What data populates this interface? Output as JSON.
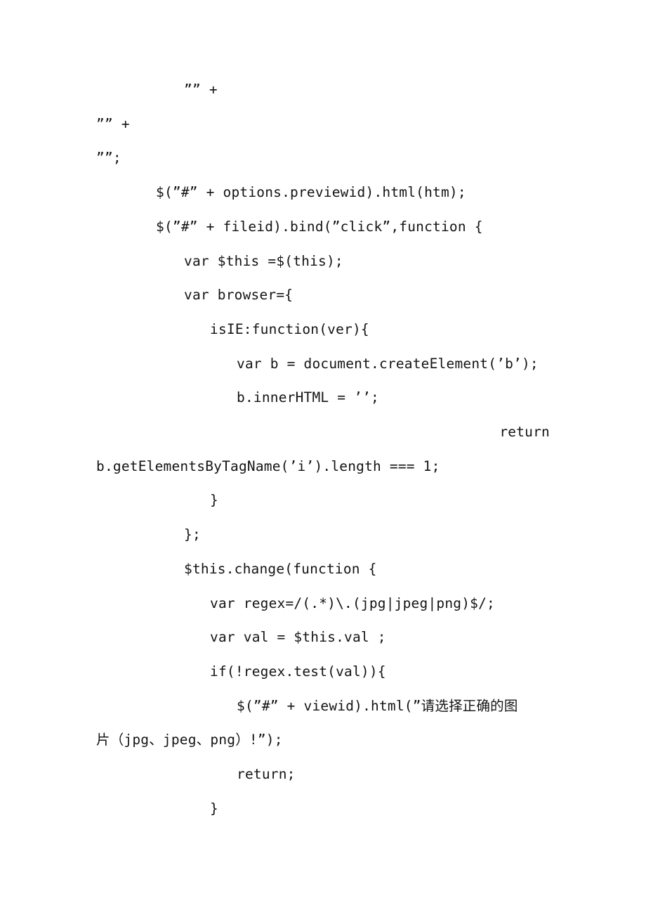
{
  "document": {
    "kind": "scanned-code-listing-page",
    "background_color": "#ffffff",
    "text_color": "#141414",
    "lines": [
      {
        "id": "l01",
        "indent": 2,
        "align": "left",
        "text": "”” +"
      },
      {
        "id": "l02",
        "indent": 0,
        "align": "left",
        "text": "”” +"
      },
      {
        "id": "l03",
        "indent": 0,
        "align": "left",
        "text": "””;"
      },
      {
        "id": "l04",
        "indent": 1,
        "align": "left",
        "text": "$(”#” + options.previewid).html(htm);"
      },
      {
        "id": "l05",
        "indent": 1,
        "align": "left",
        "text": "$(”#” + fileid).bind(”click”,function {"
      },
      {
        "id": "l06",
        "indent": 2,
        "align": "left",
        "text": "var $this =$(this);"
      },
      {
        "id": "l07",
        "indent": 2,
        "align": "left",
        "text": "var browser={"
      },
      {
        "id": "l08",
        "indent": 3,
        "align": "left",
        "text": "isIE:function(ver){"
      },
      {
        "id": "l09",
        "indent": 4,
        "align": "left",
        "text": "var b = document.createElement(’b’);"
      },
      {
        "id": "l10",
        "indent": 4,
        "align": "left",
        "text": "b.innerHTML = ’’;"
      },
      {
        "id": "l11",
        "indent": 0,
        "align": "right",
        "text": "return"
      },
      {
        "id": "l12",
        "indent": 0,
        "align": "left",
        "text": "b.getElementsByTagName(’i’).length === 1;"
      },
      {
        "id": "l13",
        "indent": 3,
        "align": "left",
        "text": "}"
      },
      {
        "id": "l14",
        "indent": 2,
        "align": "left",
        "text": "};"
      },
      {
        "id": "l15",
        "indent": 2,
        "align": "left",
        "text": "$this.change(function {"
      },
      {
        "id": "l16",
        "indent": 3,
        "align": "left",
        "text": "var regex=/(.*)\\.(jpg|jpeg|png)$/;"
      },
      {
        "id": "l17",
        "indent": 3,
        "align": "left",
        "text": "var val = $this.val ;"
      },
      {
        "id": "l18",
        "indent": 3,
        "align": "left",
        "text": "if(!regex.test(val)){"
      },
      {
        "id": "l19",
        "indent": 4,
        "align": "left",
        "text": "$(”#” + viewid).html(”请选择正确的图"
      },
      {
        "id": "l20",
        "indent": 0,
        "align": "left",
        "text": "片（jpg、jpeg、png）!”);"
      },
      {
        "id": "l21",
        "indent": 4,
        "align": "left",
        "text": "return;"
      },
      {
        "id": "l22",
        "indent": 3,
        "align": "left",
        "text": "}"
      }
    ]
  }
}
